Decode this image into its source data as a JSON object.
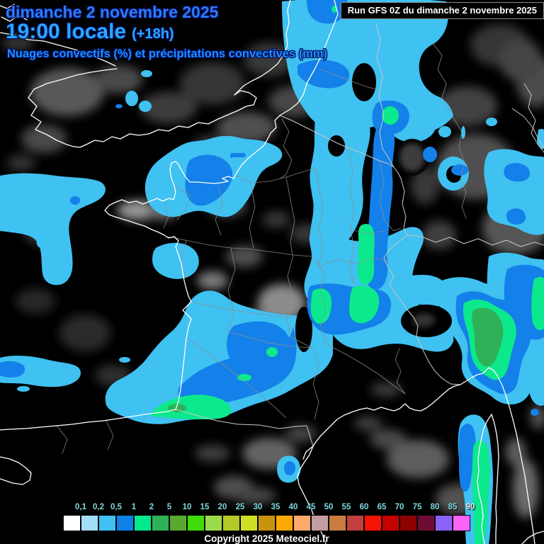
{
  "header": {
    "date": "dimanche 2 novembre 2025",
    "time": "19:00 locale",
    "offset": "(+18h)",
    "subtitle": "Nuages convectifs (%) et précipitations convectives (mm)"
  },
  "run_info": {
    "text": "Run GFS 0Z du dimanche 2 novembre 2025"
  },
  "legend": {
    "values": [
      "0,1",
      "0,2",
      "0,5",
      "1",
      "2",
      "5",
      "10",
      "15",
      "20",
      "25",
      "30",
      "35",
      "40",
      "45",
      "50",
      "55",
      "60",
      "65",
      "70",
      "75",
      "80",
      "85",
      "90"
    ],
    "colors": [
      "#ffffff",
      "#a4ddf6",
      "#3fc1f1",
      "#1080e8",
      "#02e88c",
      "#2fb257",
      "#5aa82f",
      "#3fdd05",
      "#9cdc4c",
      "#b5c929",
      "#d0de26",
      "#c9930d",
      "#fca802",
      "#fca96b",
      "#c49ca4",
      "#c87c3f",
      "#c13f3f",
      "#f81206",
      "#c50000",
      "#8f0000",
      "#6d0d35",
      "#8a62f8",
      "#fa64fa"
    ],
    "label_color": "#7fd8df"
  },
  "footer": {
    "copyright": "Copyright 2025 Meteociel.fr"
  },
  "map_colors": {
    "background": "#000000",
    "cloud_gray": "#585858",
    "precip_trace": "#3fc1f1",
    "precip_light": "#1480e9",
    "precip_moderate": "#0ce98c",
    "precip_heavy": "#2fb257",
    "coastline": "#ffffff",
    "country_border": "#cccccc",
    "department_border": "#8f8f8f"
  }
}
